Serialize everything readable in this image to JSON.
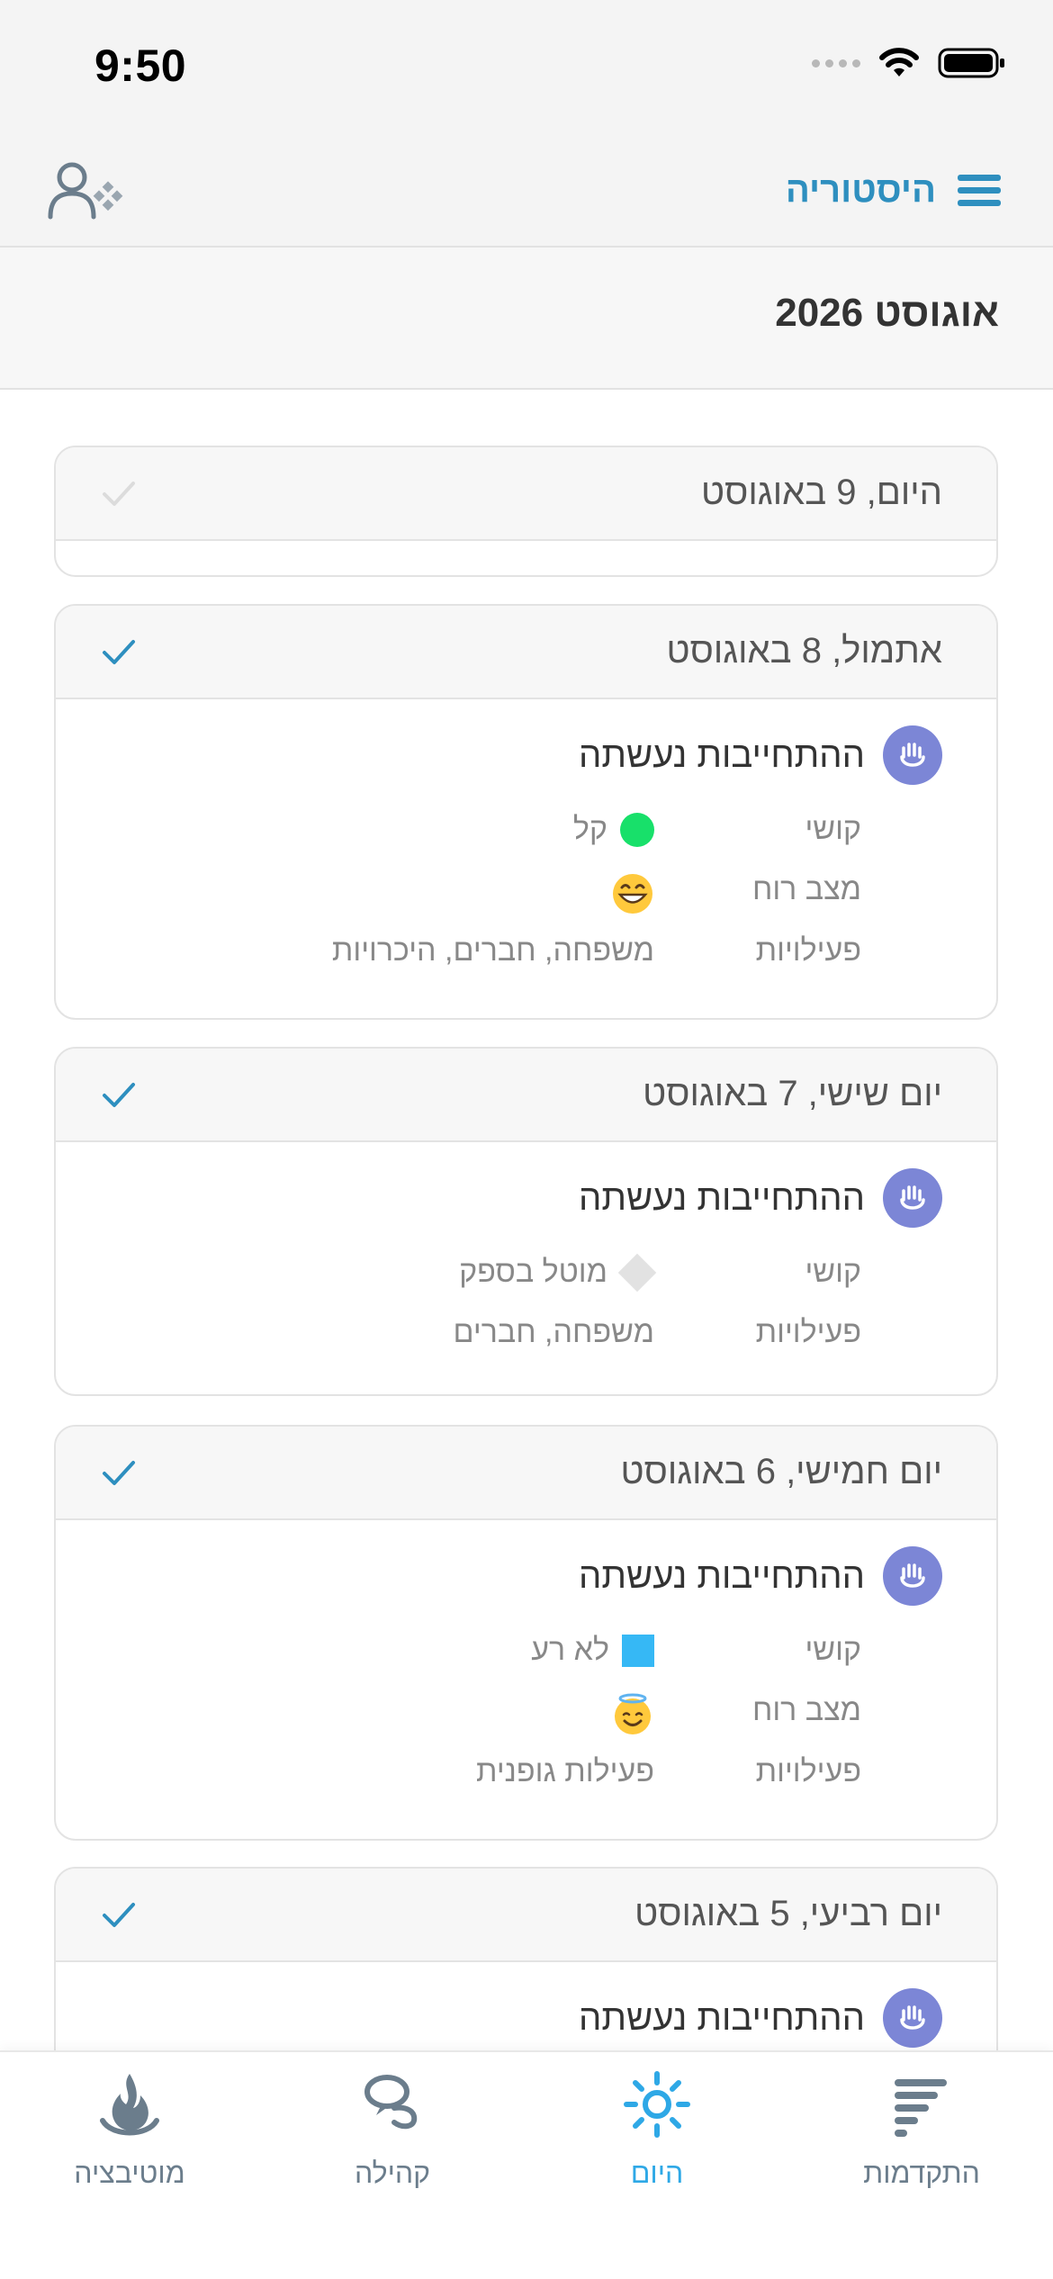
{
  "status_bar": {
    "time": "9:50"
  },
  "nav": {
    "title": "היסטוריה"
  },
  "month": {
    "title": "אוגוסט 2026"
  },
  "cards": [
    {
      "date": "היום, 9 באוגוסט",
      "checked": false
    },
    {
      "date": "אתמול, 8 באוגוסט",
      "checked": true,
      "commitment": "ההתחייבות נעשתה",
      "difficulty_label": "קושי",
      "difficulty_value": "קל",
      "difficulty_marker": "green-circle",
      "mood_label": "מצב רוח",
      "mood_icon": "grinning-face",
      "activities_label": "פעילויות",
      "activities_value": "משפחה, חברים, היכרויות"
    },
    {
      "date": "יום שישי, 7 באוגוסט",
      "checked": true,
      "commitment": "ההתחייבות נעשתה",
      "difficulty_label": "קושי",
      "difficulty_value": "מוטל בספק",
      "difficulty_marker": "grey-diamond",
      "activities_label": "פעילויות",
      "activities_value": "משפחה, חברים"
    },
    {
      "date": "יום חמישי, 6 באוגוסט",
      "checked": true,
      "commitment": "ההתחייבות נעשתה",
      "difficulty_label": "קושי",
      "difficulty_value": "לא רע",
      "difficulty_marker": "blue-square",
      "mood_label": "מצב רוח",
      "mood_icon": "smiling-face-with-halo",
      "activities_label": "פעילויות",
      "activities_value": "פעילות גופנית"
    },
    {
      "date": "יום רביעי, 5 באוגוסט",
      "checked": true,
      "commitment": "ההתחייבות נעשתה"
    }
  ],
  "tabs": [
    {
      "label": "התקדמות",
      "icon": "progress-bars-icon",
      "active": false
    },
    {
      "label": "היום",
      "icon": "sun-icon",
      "active": true
    },
    {
      "label": "קהילה",
      "icon": "community-icon",
      "active": false
    },
    {
      "label": "מוטיבציה",
      "icon": "motivation-icon",
      "active": false
    }
  ],
  "colors": {
    "accent": "#2e8fbf",
    "active_tab": "#2ea8e6",
    "commit_icon": "#7c86d6",
    "easy": "#18e06a",
    "not_bad": "#36b8f5",
    "doubtful": "#e2e2e2"
  }
}
